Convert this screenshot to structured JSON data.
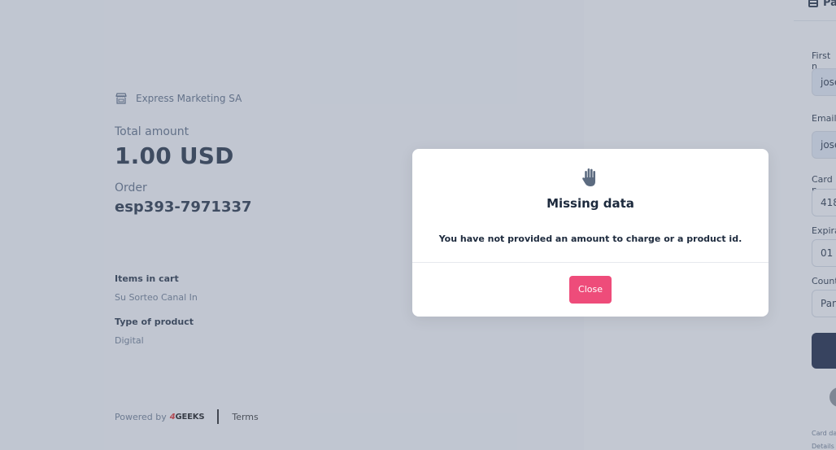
{
  "merchant": {
    "name": "Express Marketing SA",
    "icon": "store-icon"
  },
  "summary": {
    "total_label": "Total amount",
    "total_value": "1.00 USD",
    "order_label": "Order",
    "order_value": "esp393-7971337",
    "items_label": "Items in cart",
    "items_value": "Su Sorteo Canal In",
    "type_label": "Type of product",
    "type_value": "Digital"
  },
  "footer": {
    "powered_by": "Powered by",
    "brand_prefix": "4",
    "brand_name": "GEEKS",
    "terms": "Terms"
  },
  "form": {
    "heading": "Pa",
    "first_name_label": "First n",
    "first_name_value": "jose",
    "email_label": "Email",
    "email_value": "jose",
    "card_label": "Card n",
    "card_value": "418",
    "expiry_label": "Expira",
    "expiry_value": "01 /",
    "country_label": "Count",
    "country_value": "Pan",
    "note_1": "Card da",
    "note_2": "Details"
  },
  "modal": {
    "icon": "hand-stop-icon",
    "title": "Missing data",
    "message": "You have not provided an amount to charge or a product id.",
    "close_label": "Close"
  },
  "colors": {
    "accent": "#ee4c7a",
    "pay_button": "#0f1b3a",
    "text_dark": "#1d2a3d"
  }
}
